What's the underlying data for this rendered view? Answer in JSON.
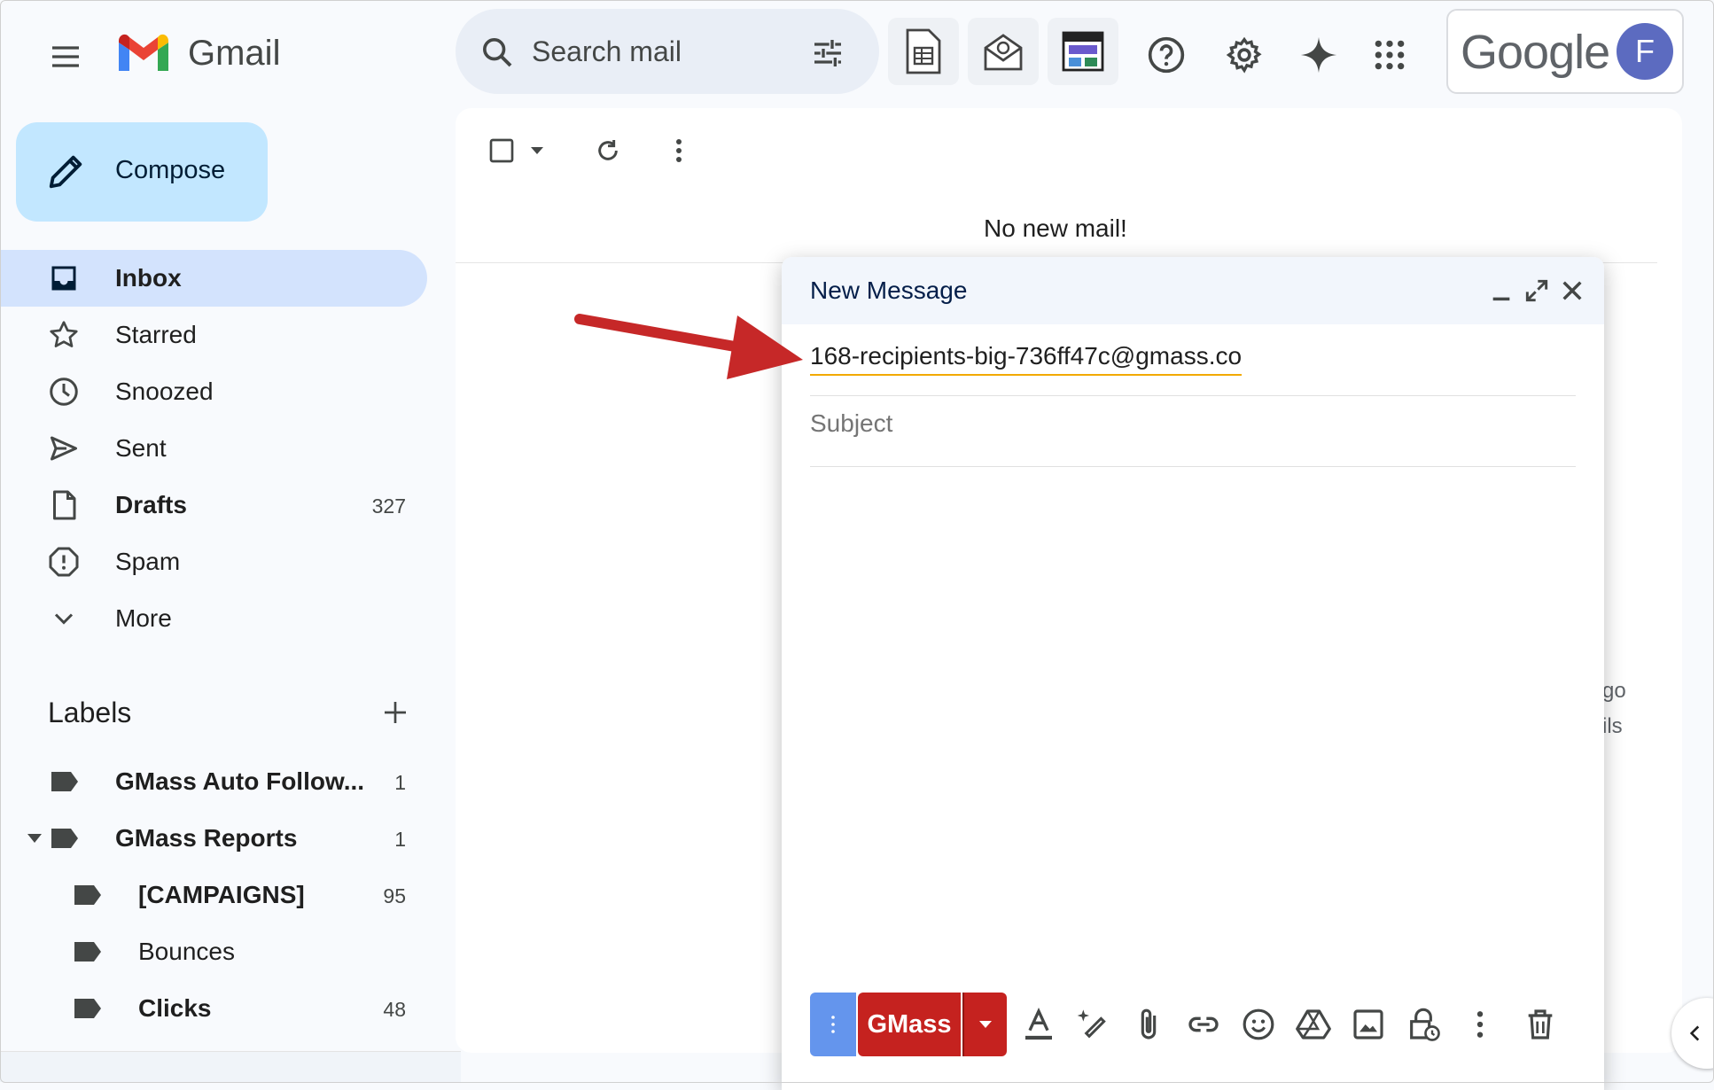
{
  "header": {
    "app_name": "Gmail",
    "search_placeholder": "Search mail",
    "google_word": "Google",
    "avatar_initial": "F"
  },
  "sidebar": {
    "compose_label": "Compose",
    "items": [
      {
        "label": "Inbox",
        "count": "",
        "icon": "inbox-icon"
      },
      {
        "label": "Starred",
        "count": "",
        "icon": "star-icon"
      },
      {
        "label": "Snoozed",
        "count": "",
        "icon": "clock-icon"
      },
      {
        "label": "Sent",
        "count": "",
        "icon": "send-icon"
      },
      {
        "label": "Drafts",
        "count": "327",
        "icon": "draft-icon"
      },
      {
        "label": "Spam",
        "count": "",
        "icon": "spam-icon"
      },
      {
        "label": "More",
        "count": "",
        "icon": "chevron-down-icon"
      }
    ],
    "labels_title": "Labels",
    "labels": [
      {
        "label": "GMass Auto Follow...",
        "count": "1"
      },
      {
        "label": "GMass Reports",
        "count": "1"
      },
      {
        "label": "[CAMPAIGNS]",
        "count": "95"
      },
      {
        "label": "Bounces",
        "count": ""
      },
      {
        "label": "Clicks",
        "count": "48"
      }
    ]
  },
  "main": {
    "empty_message": "No new mail!",
    "ghost_text_1": "go",
    "ghost_text_2": "ils"
  },
  "compose_window": {
    "title": "New Message",
    "recipient": "168-recipients-big-736ff47c@gmass.co",
    "subject_placeholder": "Subject",
    "send_button": "GMass"
  },
  "colors": {
    "compose_bg": "#c2e7ff",
    "active_nav": "#d3e3fd",
    "gmass_red": "#c5221f",
    "options_blue": "#6495ed",
    "annotation_arrow": "#c62828"
  }
}
